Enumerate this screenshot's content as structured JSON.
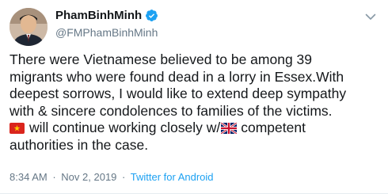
{
  "author": {
    "display_name": "PhamBinhMinh",
    "handle": "@FMPhamBinhMinh",
    "verified": true,
    "avatar_icon": "avatar-photo"
  },
  "tweet": {
    "lines": [
      {
        "text": "There were Vietnamese believed to be among 39"
      },
      {
        "text": "migrants who were found dead in a lorry in Essex.With"
      },
      {
        "text": "deepest sorrows, I would like to extend deep sympathy"
      },
      {
        "text": "with & sincere condolences to families of the victims."
      }
    ],
    "line5": {
      "flag_vn_icon": "vietnam-flag-emoji",
      "text_before_uk": "will continue working closely w/",
      "flag_uk_icon": "uk-flag-emoji",
      "text_after_uk": "competent"
    },
    "line6": "authorities in the case."
  },
  "meta": {
    "time": "8:34 AM",
    "separator": "·",
    "date": "Nov 2, 2019",
    "client": "Twitter for Android"
  },
  "colors": {
    "primary_text": "#14171a",
    "secondary_text": "#657786",
    "accent": "#1da1f2"
  }
}
